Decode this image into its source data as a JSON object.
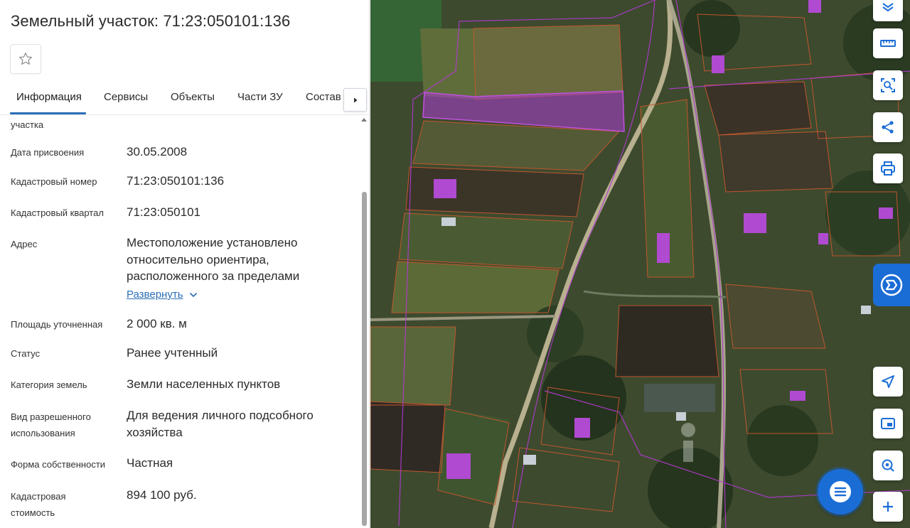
{
  "header": {
    "title": "Земельный участок: 71:23:050101:136"
  },
  "tabs": [
    {
      "label": "Информация",
      "active": true
    },
    {
      "label": "Сервисы"
    },
    {
      "label": "Объекты"
    },
    {
      "label": "Части ЗУ"
    },
    {
      "label": "Состав"
    }
  ],
  "info": {
    "partial_label": "участка",
    "rows": [
      {
        "label": "Дата присвоения",
        "value": "30.05.2008"
      },
      {
        "label": "Кадастровый номер",
        "value": "71:23:050101:136"
      },
      {
        "label": "Кадастровый квартал",
        "value": "71:23:050101"
      },
      {
        "label": "Адрес",
        "value_lines": [
          "Местоположение установлено",
          "относительно ориентира,",
          "расположенного за пределами"
        ],
        "expand_label": "Развернуть"
      },
      {
        "label": "Площадь уточненная",
        "value": "2 000 кв. м"
      },
      {
        "label": "Статус",
        "value": "Ранее учтенный"
      },
      {
        "label": "Категория земель",
        "value": "Земли населенных пунктов"
      },
      {
        "label_lines": [
          "Вид разрешенного",
          "использования"
        ],
        "value_lines": [
          "Для ведения личного подсобного",
          "хозяйства"
        ]
      },
      {
        "label": "Форма собственности",
        "value": "Частная"
      },
      {
        "label_lines": [
          "Кадастровая",
          "стоимость"
        ],
        "value": "894 100 руб."
      }
    ]
  },
  "map": {
    "highlight_color": "#a43ec4",
    "boundary_color": "#c0572e",
    "controls": [
      "layers-icon",
      "ruler-icon",
      "area-select-icon",
      "share-icon",
      "print-icon",
      "side-panel-icon",
      "locate-icon",
      "minimap-icon",
      "pin-search-icon",
      "zoom-in-icon",
      "chat-icon"
    ]
  },
  "colors": {
    "accent": "#2a6fb5",
    "chat_bg": "#1b6dd6"
  }
}
